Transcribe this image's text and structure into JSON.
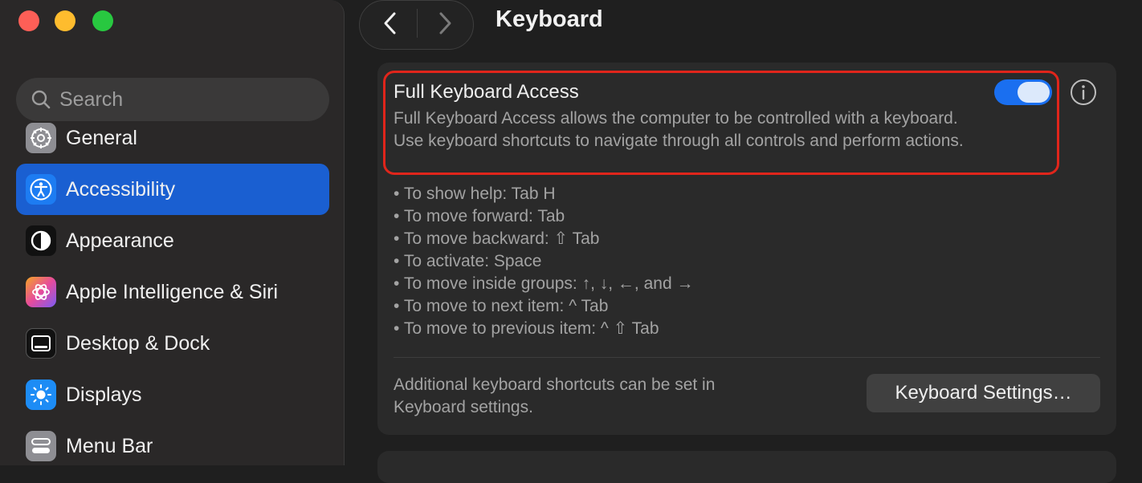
{
  "window": {
    "title": "Keyboard"
  },
  "sidebar": {
    "search_placeholder": "Search",
    "items": [
      {
        "label": "General",
        "icon": "gear-icon"
      },
      {
        "label": "Accessibility",
        "icon": "accessibility-icon",
        "selected": true
      },
      {
        "label": "Appearance",
        "icon": "appearance-icon"
      },
      {
        "label": "Apple Intelligence & Siri",
        "icon": "siri-icon"
      },
      {
        "label": "Desktop & Dock",
        "icon": "dock-icon"
      },
      {
        "label": "Displays",
        "icon": "displays-icon"
      },
      {
        "label": "Menu Bar",
        "icon": "menubar-icon"
      }
    ]
  },
  "main": {
    "full_keyboard_access": {
      "title": "Full Keyboard Access",
      "description": "Full Keyboard Access allows the computer to be controlled with a keyboard. Use keyboard shortcuts to navigate through all controls and perform actions.",
      "enabled": true
    },
    "tips": [
      "To show help: Tab H",
      "To move forward: Tab",
      "To move backward: ⇧ Tab",
      "To activate: Space",
      "To move inside groups: ↑, ↓, ←, and →",
      "To move to next item: ^ Tab",
      "To move to previous item: ^ ⇧ Tab"
    ],
    "additional_text": "Additional keyboard shortcuts can be set in Keyboard settings.",
    "keyboard_settings_button": "Keyboard Settings…"
  },
  "colors": {
    "accent": "#1a6ff0",
    "selection": "#1a5fd1",
    "highlight_border": "#e0251b"
  }
}
